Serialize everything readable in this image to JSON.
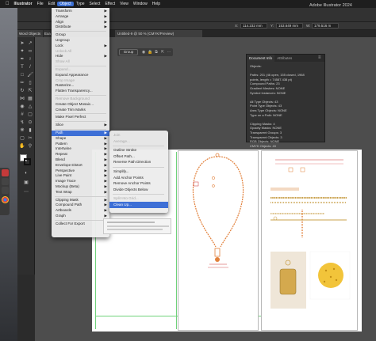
{
  "menubar": {
    "apple": "",
    "items": [
      "Illustrator",
      "File",
      "Edit",
      "Object",
      "Type",
      "Select",
      "Effect",
      "View",
      "Window",
      "Help"
    ],
    "active_index": 3
  },
  "window": {
    "title": "Adobe Illustrator 2024"
  },
  "control": {
    "x_value": "114.232 mm",
    "y_value": "153.649 mm",
    "w_label": "W:",
    "w_value": "179.516 m"
  },
  "tabs": {
    "word_objects": "Word Objects",
    "exa_tab": "Exa",
    "document": "Untitled-9 @ 50 % (CMYK/Preview)"
  },
  "context": {
    "group_label": "Group"
  },
  "docinfo": {
    "tabs": [
      "Document Info",
      "Attributes"
    ],
    "lines": [
      "Objects:",
      "",
      "Paths: 201 (46 open, 155 closed, 1968",
      "points, length = 74587.438 pt)",
      "Compound Paths: 23",
      "Gradient Meshes: NONE",
      "Symbol Instances: NONE",
      "",
      "All Type Objects: 43",
      "Point Type Objects: 43",
      "Area Type Objects: NONE",
      "Type on a Path: NONE",
      "",
      "Clipping Masks: 4",
      "Opacity Masks: NONE",
      "Transparent Groups: 3",
      "Transparent Objects: 3",
      "RGB Objects: NONE",
      "CMYK Objects: 43"
    ]
  },
  "object_menu": {
    "items": [
      {
        "label": "Transform",
        "arrow": true
      },
      {
        "label": "Arrange",
        "arrow": true
      },
      {
        "label": "Align",
        "arrow": true
      },
      {
        "label": "Distribute",
        "arrow": true
      },
      {
        "sep": true
      },
      {
        "label": "Group"
      },
      {
        "label": "Ungroup"
      },
      {
        "label": "Lock",
        "arrow": true
      },
      {
        "label": "Unlock All",
        "disabled": true
      },
      {
        "label": "Hide",
        "arrow": true
      },
      {
        "label": "Show All",
        "disabled": true
      },
      {
        "sep": true
      },
      {
        "label": "Expand...",
        "disabled": true
      },
      {
        "label": "Expand Appearance"
      },
      {
        "label": "Crop Image",
        "disabled": true
      },
      {
        "label": "Rasterize..."
      },
      {
        "label": "Flatten Transparency..."
      },
      {
        "sep": true
      },
      {
        "label": "Remove Background",
        "disabled": true
      },
      {
        "label": "Create Object Mosaic..."
      },
      {
        "label": "Create Trim Marks"
      },
      {
        "sep": true
      },
      {
        "label": "Make Pixel Perfect"
      },
      {
        "sep": true
      },
      {
        "label": "Slice",
        "arrow": true
      },
      {
        "sep": true
      },
      {
        "label": "Path",
        "arrow": true,
        "highlight": true
      },
      {
        "label": "Shape",
        "arrow": true
      },
      {
        "label": "Pattern",
        "arrow": true
      },
      {
        "label": "Intertwine",
        "arrow": true
      },
      {
        "label": "Repeat",
        "arrow": true
      },
      {
        "label": "Blend",
        "arrow": true
      },
      {
        "label": "Envelope Distort",
        "arrow": true
      },
      {
        "label": "Perspective",
        "arrow": true
      },
      {
        "label": "Live Paint",
        "arrow": true
      },
      {
        "label": "Image Trace",
        "arrow": true
      },
      {
        "label": "Mockup (Beta)",
        "arrow": true
      },
      {
        "label": "Text Wrap",
        "arrow": true
      },
      {
        "sep": true
      },
      {
        "label": "Clipping Mask",
        "arrow": true
      },
      {
        "label": "Compound Path",
        "arrow": true
      },
      {
        "label": "Artboards",
        "arrow": true
      },
      {
        "label": "Graph",
        "arrow": true
      },
      {
        "sep": true
      },
      {
        "label": "Collect For Export",
        "arrow": true
      }
    ]
  },
  "path_menu": {
    "items": [
      {
        "label": "Join",
        "disabled": true
      },
      {
        "label": "Average...",
        "disabled": true
      },
      {
        "sep": true
      },
      {
        "label": "Outline Stroke"
      },
      {
        "label": "Offset Path..."
      },
      {
        "label": "Reverse Path Direction"
      },
      {
        "sep": true
      },
      {
        "label": "Simplify..."
      },
      {
        "label": "Add Anchor Points"
      },
      {
        "label": "Remove Anchor Points"
      },
      {
        "label": "Divide Objects Below"
      },
      {
        "sep": true
      },
      {
        "label": "Split Into Grid...",
        "disabled": true
      },
      {
        "label": "Clean Up...",
        "highlight": true
      }
    ]
  },
  "colors": {
    "accent": "#3d6fd6",
    "chain": "#e2813c"
  }
}
